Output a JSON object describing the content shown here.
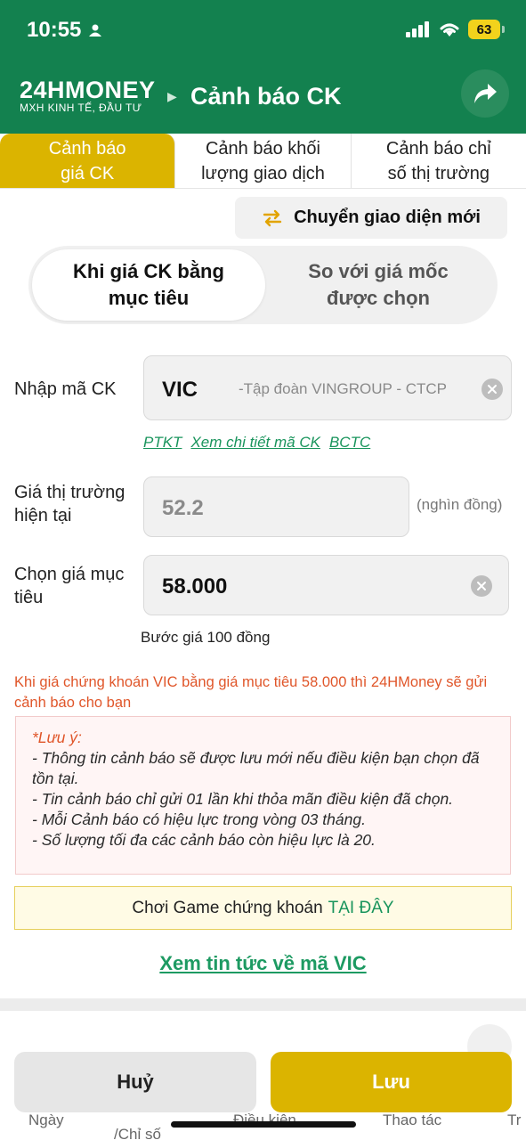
{
  "status_bar": {
    "time": "10:55",
    "battery": "63"
  },
  "header": {
    "logo_main": "24HMONEY",
    "logo_sub": "MXH KINH TẾ, ĐẦU TƯ",
    "title": "Cảnh báo CK"
  },
  "tabs": [
    {
      "label": "Cảnh báo\ngiá CK",
      "active": true
    },
    {
      "label": "Cảnh báo khối\nlượng giao dịch",
      "active": false
    },
    {
      "label": "Cảnh báo chỉ\nsố thị trường",
      "active": false
    }
  ],
  "switch_button": "Chuyển giao diện mới",
  "segments": {
    "active": "Khi giá CK bằng\nmục tiêu",
    "inactive": "So với giá mốc\nđược chọn"
  },
  "form": {
    "ticker_label": "Nhập mã CK",
    "ticker_value": "VIC",
    "ticker_company": "-Tập đoàn VINGROUP - CTCP",
    "links": [
      "PTKT",
      "Xem chi tiết mã CK",
      "BCTC"
    ],
    "market_price_label": "Giá thị trường\nhiện tại",
    "market_price_value": "52.2",
    "unit": "(nghìn đồng)",
    "target_label": "Chọn giá mục\ntiêu",
    "target_value": "58.000",
    "step_text": "Bước giá 100 đồng"
  },
  "alert_text": "Khi giá chứng khoán VIC bằng giá mục tiêu 58.000 thì 24HMoney sẽ gửi cảnh báo cho bạn",
  "note": {
    "title": "*Lưu ý:",
    "lines": [
      "- Thông tin cảnh báo sẽ được lưu mới nếu điều kiện bạn chọn đã tồn tại.",
      "- Tin cảnh báo chỉ gửi 01 lần khi thỏa mãn điều kiện đã chọn.",
      "- Mỗi Cảnh báo có hiệu lực trong vòng 03 tháng.",
      "- Số lượng tối đa các cảnh báo còn hiệu lực là 20."
    ]
  },
  "game_banner": {
    "text": "Chơi Game chứng khoán",
    "link": "TẠI ĐÂY"
  },
  "news_link": "Xem tin tức về mã VIC",
  "table_headers_partial": [
    "Ngày",
    "/Chỉ số",
    "Điều kiện",
    "Thao tác",
    "Tr"
  ],
  "buttons": {
    "cancel": "Huỷ",
    "save": "Lưu"
  },
  "colors": {
    "header_green": "#13814f",
    "accent_gold": "#dbb400",
    "link_green": "#19945c",
    "alert_orange": "#e0562a"
  }
}
